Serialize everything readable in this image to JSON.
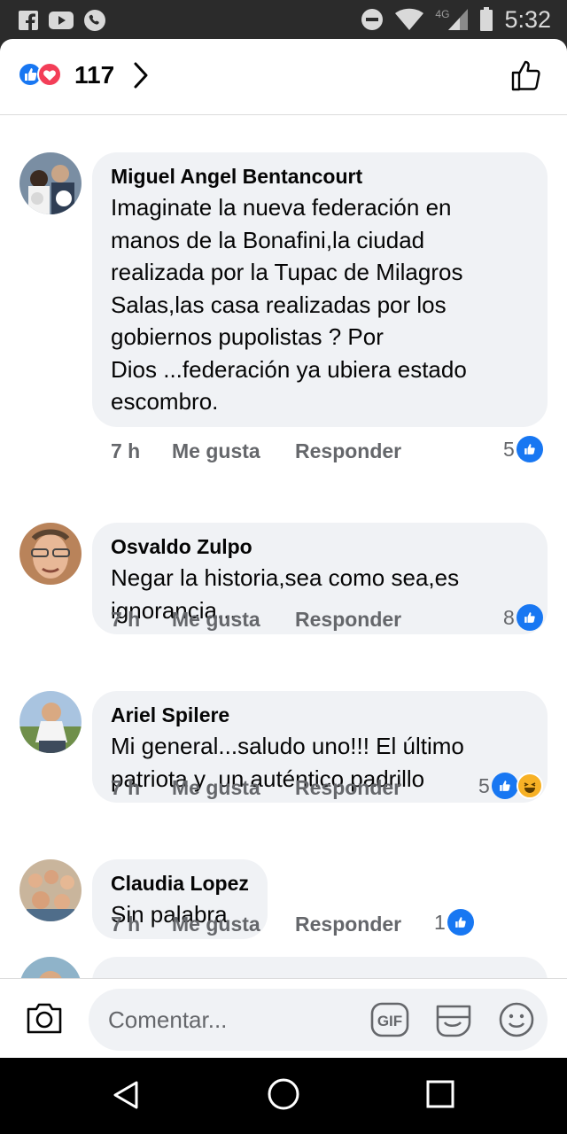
{
  "status_bar": {
    "time": "5:32",
    "network": "4G",
    "left_icons": [
      "facebook-icon",
      "youtube-icon",
      "phone-icon"
    ],
    "right_icons": [
      "do-not-disturb-icon",
      "wifi-icon",
      "signal-icon",
      "battery-icon"
    ]
  },
  "header": {
    "reaction_count": "117",
    "reaction_icons": [
      "like-reaction-icon",
      "love-reaction-icon"
    ]
  },
  "comments": [
    {
      "author": "Miguel Angel Bentancourt",
      "lines": [
        "Imaginate la nueva federación en",
        "manos de la Bonafini,la ciudad",
        "realizada por la Tupac de Milagros",
        "Salas,las casa realizadas por los",
        "gobiernos pupolistas ? Por",
        "Dios ...federación ya ubiera estado",
        "escombro."
      ],
      "time": "7 h",
      "like_label": "Me gusta",
      "reply_label": "Responder",
      "reactions": "5"
    },
    {
      "author": "Osvaldo Zulpo",
      "lines": [
        "Negar la historia,sea como sea,es",
        "ignorancia..."
      ],
      "time": "7 h",
      "like_label": "Me gusta",
      "reply_label": "Responder",
      "reactions": "8"
    },
    {
      "author": "Ariel Spilere",
      "lines": [
        "Mi general...saludo uno!!! El último",
        "patriota y  un auténtico padrillo"
      ],
      "time": "7 h",
      "like_label": "Me gusta",
      "reply_label": "Responder",
      "reactions": "5"
    },
    {
      "author": "Claudia Lopez",
      "lines": [
        "Sin palabra"
      ],
      "time": "7 h",
      "like_label": "Me gusta",
      "reply_label": "Responder",
      "reactions": "1"
    }
  ],
  "composer": {
    "placeholder": "Comentar...",
    "gif_label": "GIF"
  },
  "colors": {
    "accent": "#1877f2",
    "love": "#f33e58",
    "bubble": "#f0f2f5",
    "secondary_text": "#65676b"
  }
}
